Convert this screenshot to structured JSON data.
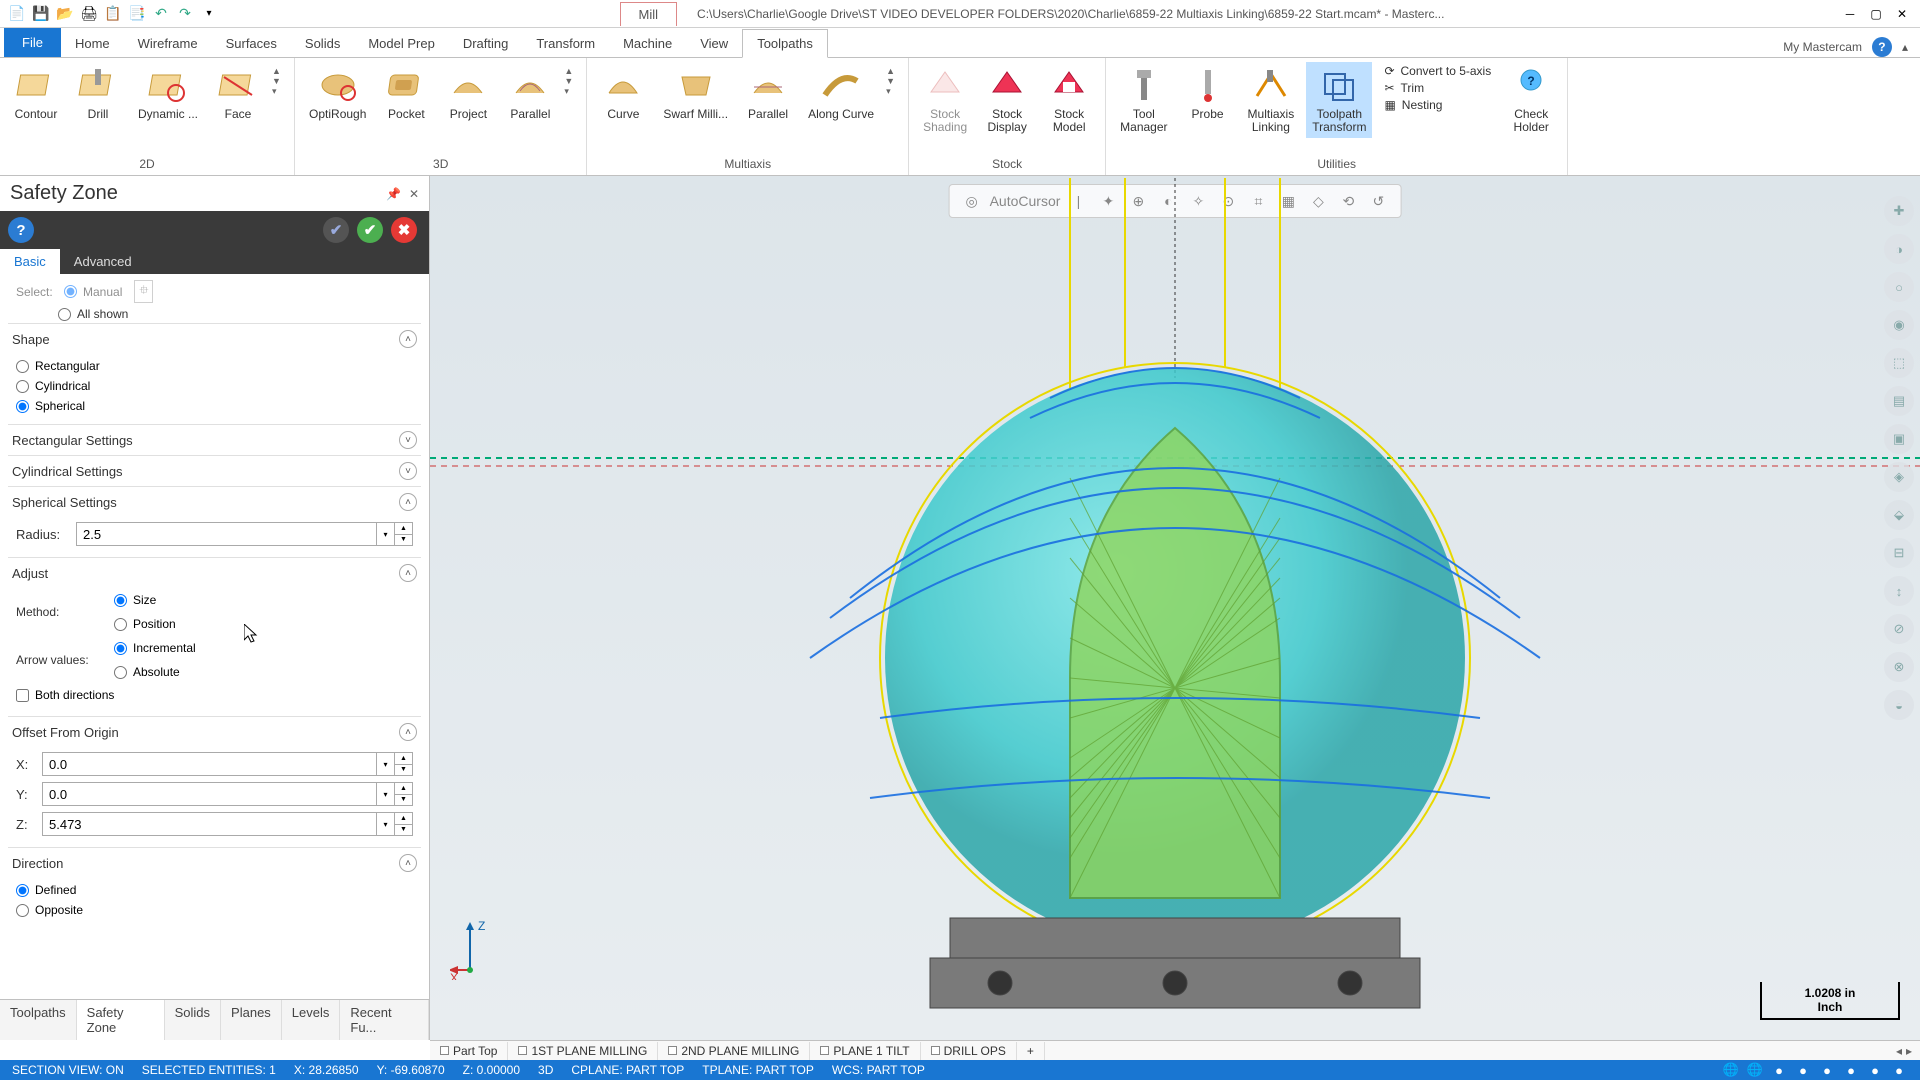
{
  "titlebar": {
    "context_tab": "Mill",
    "path": "C:\\Users\\Charlie\\Google Drive\\ST VIDEO DEVELOPER FOLDERS\\2020\\Charlie\\6859-22 Multiaxis Linking\\6859-22 Start.mcam* - Masterc..."
  },
  "tabs": {
    "file": "File",
    "home": "Home",
    "wireframe": "Wireframe",
    "surfaces": "Surfaces",
    "solids": "Solids",
    "modelprep": "Model Prep",
    "drafting": "Drafting",
    "transform": "Transform",
    "machine": "Machine",
    "view": "View",
    "toolpaths": "Toolpaths",
    "my_mastercam": "My Mastercam"
  },
  "ribbon": {
    "g1": {
      "label": "2D",
      "contour": "Contour",
      "drill": "Drill",
      "dynamic": "Dynamic ...",
      "face": "Face"
    },
    "g2": {
      "label": "3D",
      "optirough": "OptiRough",
      "pocket": "Pocket",
      "project": "Project",
      "parallel": "Parallel"
    },
    "g3": {
      "label": "Multiaxis",
      "curve": "Curve",
      "swarf": "Swarf Milli...",
      "parallel": "Parallel",
      "along": "Along Curve"
    },
    "g4": {
      "label": "Stock",
      "shading": "Stock\nShading",
      "display": "Stock\nDisplay",
      "model": "Stock\nModel"
    },
    "utilities": {
      "label": "Utilities",
      "tool_manager": "Tool\nManager",
      "probe": "Probe",
      "multiaxis_linking": "Multiaxis\nLinking",
      "toolpath_transform": "Toolpath\nTransform",
      "convert5": "Convert to 5-axis",
      "trim": "Trim",
      "nesting": "Nesting",
      "check_holder": "Check\nHolder"
    }
  },
  "panel": {
    "title": "Safety Zone",
    "tabs": {
      "basic": "Basic",
      "advanced": "Advanced"
    },
    "select_manual": "Manual",
    "select_all": "All shown",
    "shape": {
      "header": "Shape",
      "rect": "Rectangular",
      "cyl": "Cylindrical",
      "sph": "Spherical"
    },
    "rect_settings": "Rectangular Settings",
    "cyl_settings": "Cylindrical Settings",
    "sph_settings": {
      "header": "Spherical Settings",
      "radius_label": "Radius:",
      "radius_value": "2.5"
    },
    "adjust": {
      "header": "Adjust",
      "method_label": "Method:",
      "size": "Size",
      "position": "Position",
      "arrow_label": "Arrow values:",
      "incremental": "Incremental",
      "absolute": "Absolute",
      "both": "Both directions"
    },
    "offset": {
      "header": "Offset From Origin",
      "x_label": "X:",
      "x_val": "0.0",
      "y_label": "Y:",
      "y_val": "0.0",
      "z_label": "Z:",
      "z_val": "5.473"
    },
    "direction": {
      "header": "Direction",
      "defined": "Defined",
      "opposite": "Opposite"
    }
  },
  "panel_tabs": {
    "toolpaths": "Toolpaths",
    "safety_zone": "Safety Zone",
    "solids": "Solids",
    "planes": "Planes",
    "levels": "Levels",
    "recent": "Recent Fu..."
  },
  "viewport": {
    "scale_value": "1.0208 in",
    "scale_unit": "Inch",
    "axis_x": "X",
    "axis_z": "Z",
    "autocursor": "AutoCursor"
  },
  "view_tabs": {
    "part_top": "Part Top",
    "p1": "1ST PLANE MILLING",
    "p2": "2ND PLANE MILLING",
    "p3": "PLANE 1 TILT",
    "p4": "DRILL OPS"
  },
  "status": {
    "section_view": "SECTION VIEW: ON",
    "selected": "SELECTED ENTITIES: 1",
    "x": "X:   28.26850",
    "y": "Y:   -69.60870",
    "z": "Z:   0.00000",
    "mode": "3D",
    "cplane": "CPLANE: PART TOP",
    "tplane": "TPLANE: PART TOP",
    "wcs": "WCS: PART TOP"
  }
}
